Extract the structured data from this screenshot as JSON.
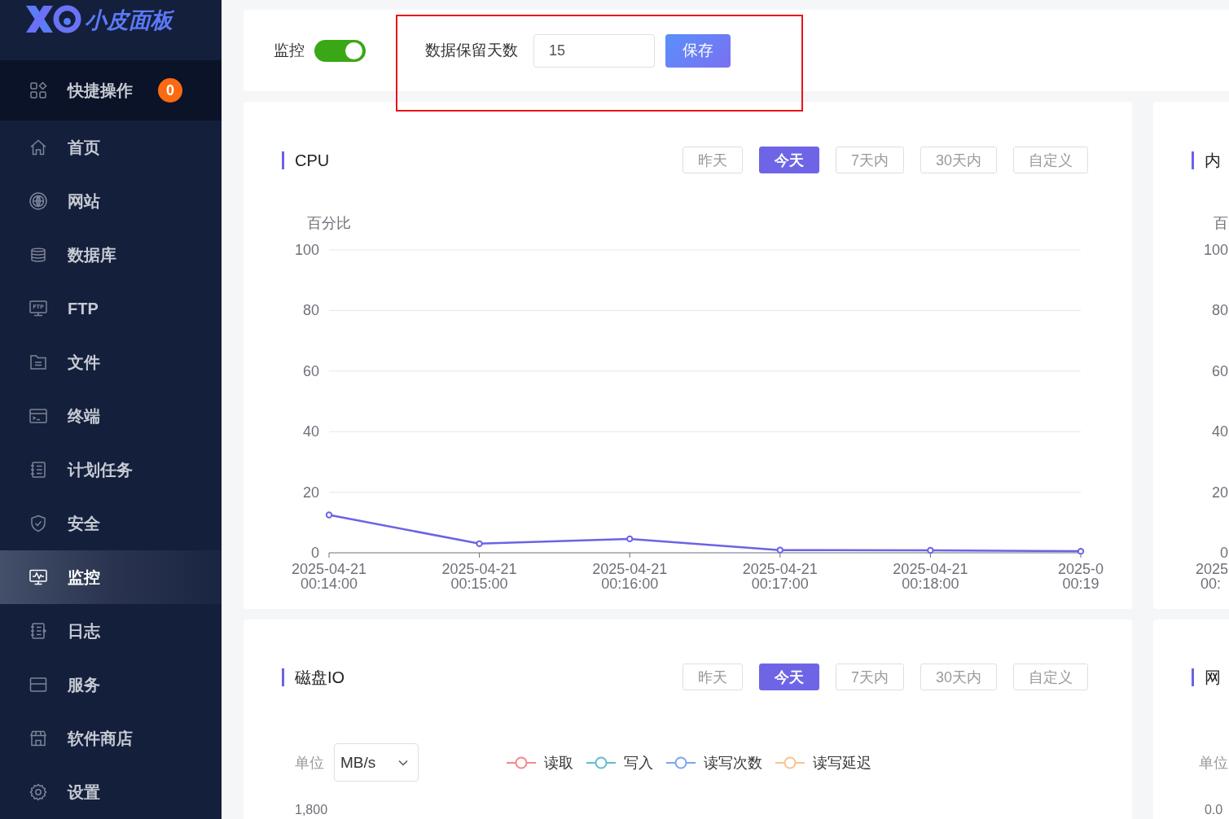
{
  "sidebar": {
    "logo_text": "小皮面板",
    "items": [
      {
        "label": "快捷操作",
        "kind": "shortcut",
        "badge": "0",
        "selected": false
      },
      {
        "label": "首页",
        "kind": "link",
        "selected": false
      },
      {
        "label": "网站",
        "kind": "link",
        "selected": false
      },
      {
        "label": "数据库",
        "kind": "link",
        "selected": false
      },
      {
        "label": "FTP",
        "kind": "link",
        "icon_text": "FTP",
        "selected": false
      },
      {
        "label": "文件",
        "kind": "link",
        "selected": false
      },
      {
        "label": "终端",
        "kind": "link",
        "selected": false
      },
      {
        "label": "计划任务",
        "kind": "link",
        "selected": false
      },
      {
        "label": "安全",
        "kind": "link",
        "selected": false
      },
      {
        "label": "监控",
        "kind": "link",
        "selected": true
      },
      {
        "label": "日志",
        "kind": "link",
        "selected": false
      },
      {
        "label": "服务",
        "kind": "link",
        "selected": false
      },
      {
        "label": "软件商店",
        "kind": "link",
        "selected": false
      },
      {
        "label": "设置",
        "kind": "link",
        "selected": false
      }
    ]
  },
  "settings_bar": {
    "monitor": {
      "label": "监控",
      "on": true
    },
    "retention": {
      "label": "数据保留天数",
      "value": "15"
    },
    "save_button": "保存"
  },
  "panels": [
    {
      "kind": "chart",
      "title": "CPU",
      "ranges": [
        {
          "label": "昨天",
          "selected": false
        },
        {
          "label": "今天",
          "selected": true
        },
        {
          "label": "7天内",
          "selected": false
        },
        {
          "label": "30天内",
          "selected": false
        },
        {
          "label": "自定义",
          "selected": false
        }
      ],
      "chart_data": {
        "type": "line",
        "ylabel": "百分比",
        "categories": [
          "2025-04-21 00:14:00",
          "2025-04-21 00:15:00",
          "2025-04-21 00:16:00",
          "2025-04-21 00:17:00",
          "2025-04-21 00:18:00",
          "2025-0 00:19"
        ],
        "series": [
          {
            "color": "#6c63e6",
            "marker": "circle",
            "values": [
              12.5,
              3.0,
              4.6,
              0.9,
              0.8,
              0.5
            ]
          }
        ],
        "ylim": [
          0,
          100
        ],
        "yticks": [
          0,
          20,
          40,
          60,
          80,
          100
        ],
        "grid": true
      }
    },
    {
      "kind": "axis",
      "title": "内",
      "y_axis_label": "百",
      "y_ticks": [
        "100",
        "80",
        "60",
        "40",
        "20",
        "0"
      ],
      "x_label": {
        "date": "2025",
        "time": "00:"
      }
    },
    {
      "kind": "io",
      "title": "磁盘IO",
      "ranges": [
        {
          "label": "昨天",
          "selected": false
        },
        {
          "label": "今天",
          "selected": true
        },
        {
          "label": "7天内",
          "selected": false
        },
        {
          "label": "30天内",
          "selected": false
        },
        {
          "label": "自定义",
          "selected": false
        }
      ],
      "unit": {
        "label": "单位",
        "value": "MB/s"
      },
      "legend": [
        {
          "label": "读取",
          "color": "#f4868c"
        },
        {
          "label": "写入",
          "color": "#62bccc"
        },
        {
          "label": "读写次数",
          "color": "#7ba4f7"
        },
        {
          "label": "读写延迟",
          "color": "#f8c28f"
        }
      ],
      "y_tick": "1,800"
    },
    {
      "kind": "unit",
      "title": "网",
      "unit": {
        "label": "单位"
      },
      "y_tick": "0.0"
    }
  ]
}
